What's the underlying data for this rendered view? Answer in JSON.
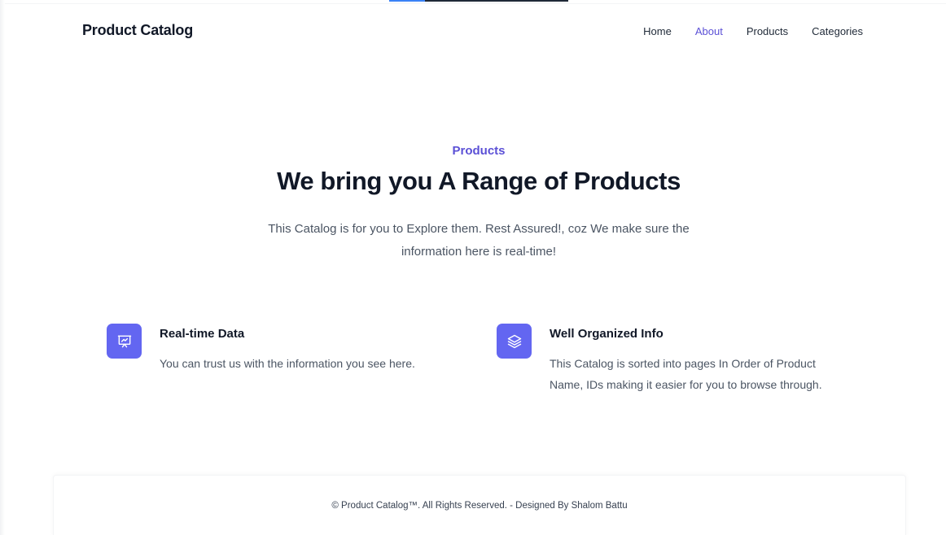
{
  "header": {
    "brand": "Product Catalog",
    "nav": [
      {
        "label": "Home",
        "active": false
      },
      {
        "label": "About",
        "active": true
      },
      {
        "label": "Products",
        "active": false
      },
      {
        "label": "Categories",
        "active": false
      }
    ]
  },
  "hero": {
    "eyebrow": "Products",
    "title": "We bring you A Range of Products",
    "subtitle": "This Catalog is for you to Explore them. Rest Assured!, coz We make sure the information here is real-time!"
  },
  "features": [
    {
      "icon": "presentation-chart-icon",
      "title": "Real-time Data",
      "description": "You can trust us with the information you see here."
    },
    {
      "icon": "layers-icon",
      "title": "Well Organized Info",
      "description": "This Catalog is sorted into pages In Order of Product Name, IDs making it easier for you to browse through."
    }
  ],
  "footer": {
    "text": "© Product Catalog™. All Rights Reserved. - Designed By Shalom Battu"
  },
  "colors": {
    "accent": "#5b50d6",
    "icon_bg": "#6366f1",
    "text_dark": "#111827",
    "text_muted": "#4b5563"
  }
}
